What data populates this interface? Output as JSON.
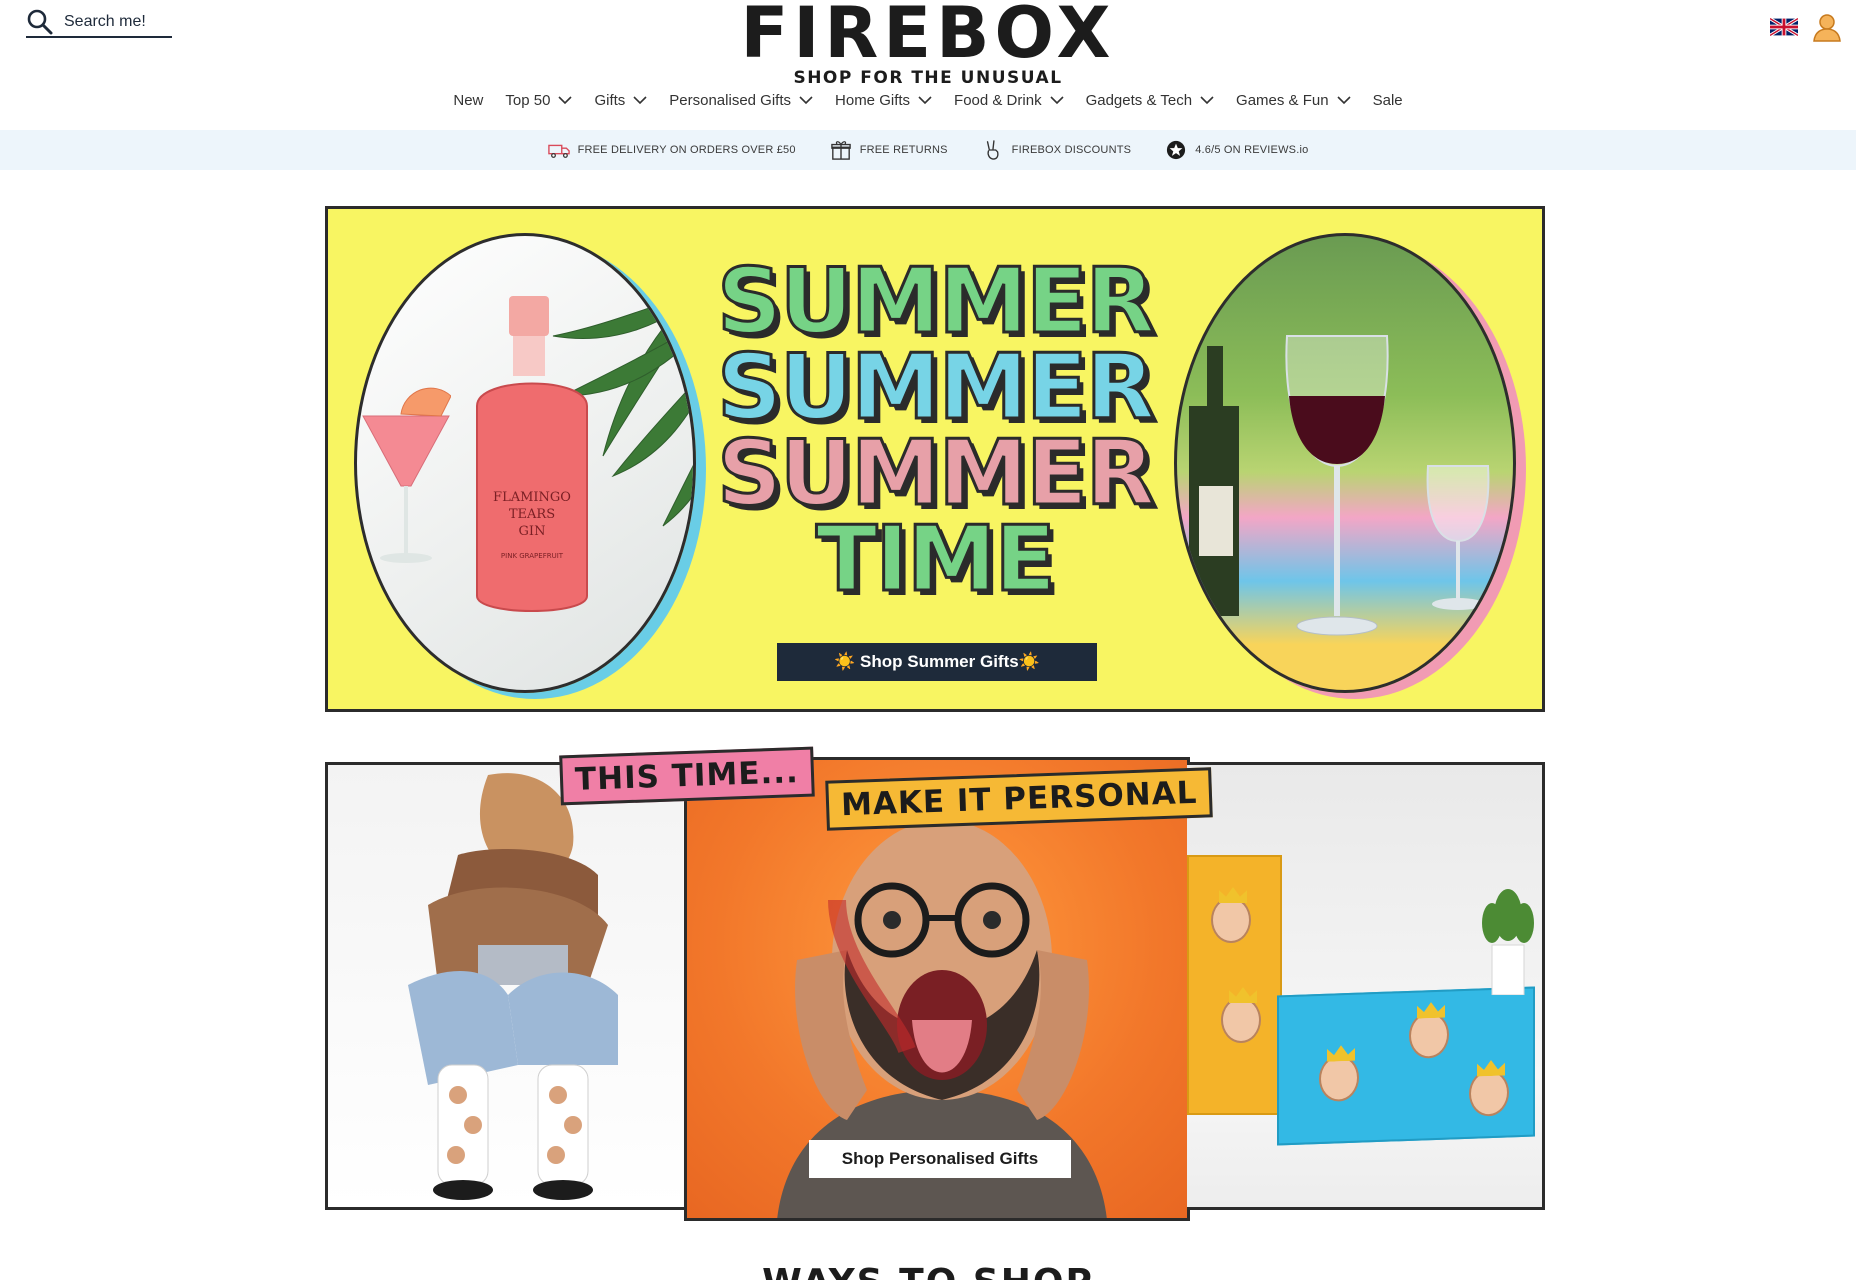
{
  "search": {
    "placeholder": "Search me!"
  },
  "logo": {
    "title": "FIREBOX",
    "tagline": "SHOP FOR THE UNUSUAL"
  },
  "nav": {
    "items": [
      {
        "label": "New",
        "dropdown": false
      },
      {
        "label": "Top 50",
        "dropdown": true
      },
      {
        "label": "Gifts",
        "dropdown": true
      },
      {
        "label": "Personalised Gifts",
        "dropdown": true
      },
      {
        "label": "Home Gifts",
        "dropdown": true
      },
      {
        "label": "Food & Drink",
        "dropdown": true
      },
      {
        "label": "Gadgets & Tech",
        "dropdown": true
      },
      {
        "label": "Games & Fun",
        "dropdown": true
      },
      {
        "label": "Sale",
        "dropdown": false
      }
    ]
  },
  "usp": {
    "delivery": "FREE DELIVERY ON ORDERS OVER £50",
    "returns": "FREE RETURNS",
    "discounts": "FIREBOX DISCOUNTS",
    "reviews": "4.6/5 ON REVIEWS.io"
  },
  "summer_banner": {
    "lines": [
      "SUMMER",
      "SUMMER",
      "SUMMER",
      "TIME"
    ],
    "button": "☀️ Shop Summer Gifts☀️",
    "bottle_label": [
      "FLAMINGO",
      "TEARS",
      "GIN",
      "PINK GRAPEFRUIT"
    ]
  },
  "personal_banner": {
    "tag1": "THIS TIME...",
    "tag2": "MAKE IT PERSONAL",
    "button": "Shop Personalised Gifts"
  },
  "section": {
    "heading": "WAYS TO SHOP"
  },
  "colors": {
    "navy": "#1e2a3a",
    "banner_yellow": "#f8f562",
    "usp_bg": "#edf5fb",
    "summer_green": "#76d386",
    "summer_blue": "#77d4e6",
    "summer_pink": "#e7a0a8",
    "tag_pink": "#f07fa6",
    "tag_yellow": "#f6b935",
    "orange_bg": "#f2772a"
  },
  "icons": [
    "search-icon",
    "uk-flag-icon",
    "user-icon",
    "chevron-down-icon",
    "delivery-van-icon",
    "gift-icon",
    "peace-hand-icon",
    "star-icon"
  ]
}
